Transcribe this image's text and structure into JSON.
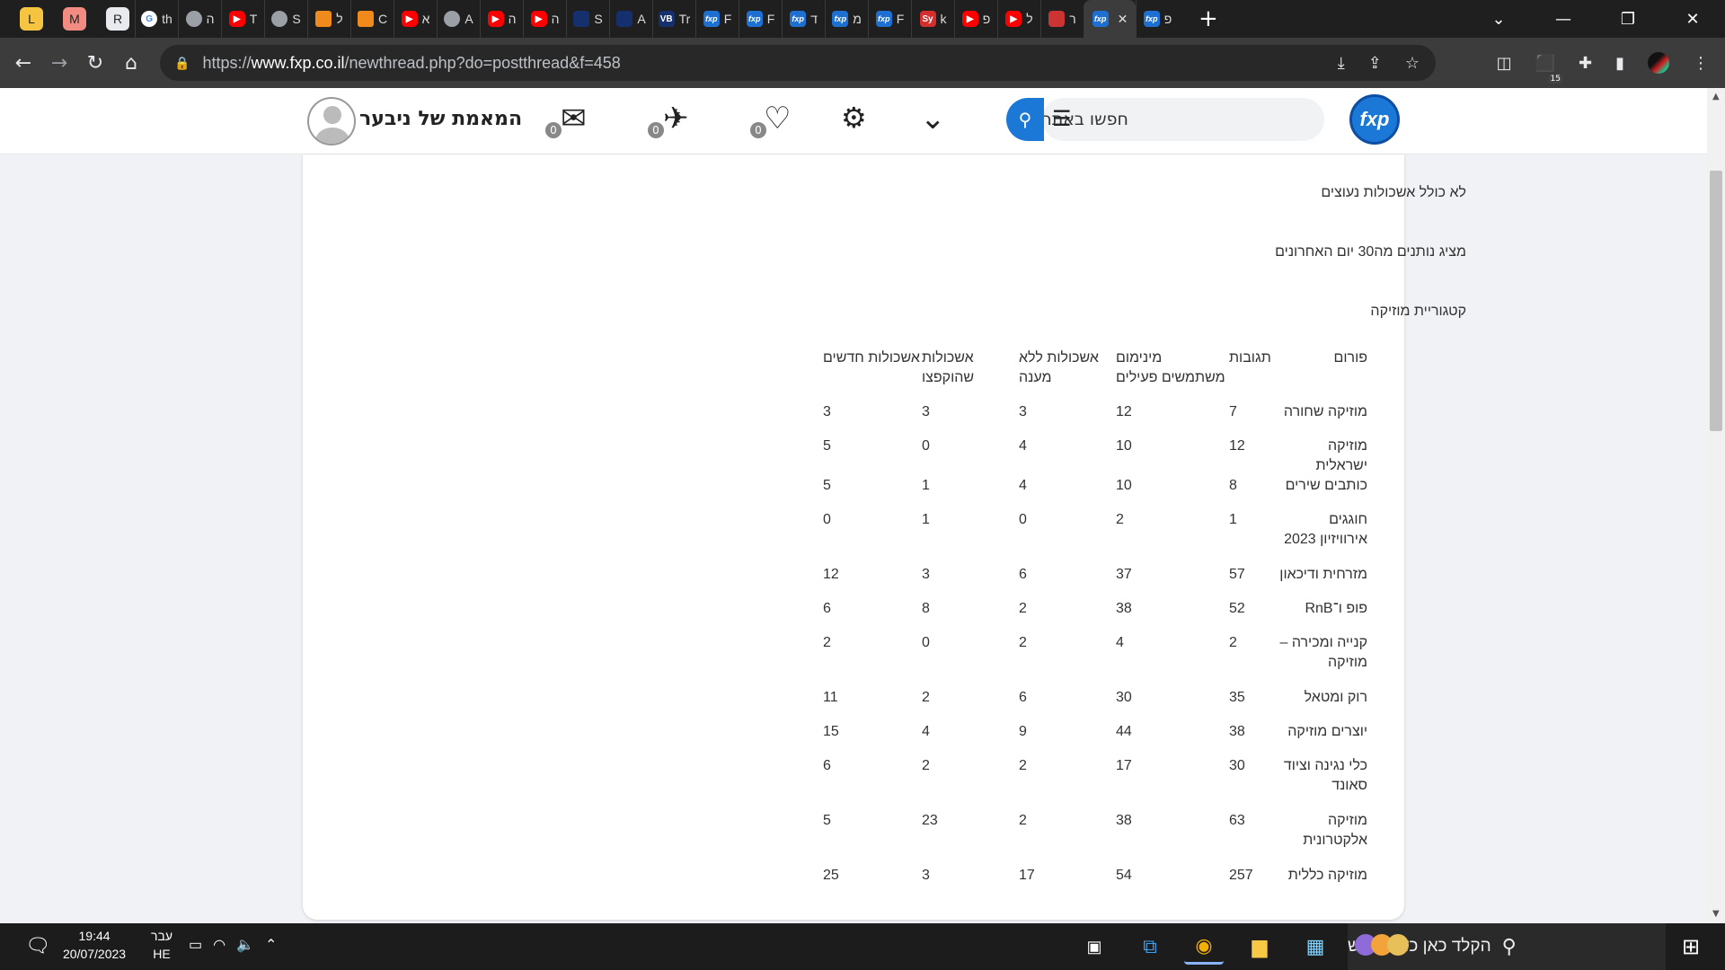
{
  "browser": {
    "pinned_tabs": [
      {
        "letter": "L",
        "color": "#f5c542"
      },
      {
        "letter": "M",
        "color": "#f28b82"
      },
      {
        "letter": "R",
        "color": "#e8eaed"
      }
    ],
    "tabs": [
      {
        "icon": "google",
        "title": "th",
        "type": "g"
      },
      {
        "icon": "globe",
        "title": "ה",
        "type": "globe"
      },
      {
        "icon": "youtube",
        "title": "T",
        "type": "yt"
      },
      {
        "icon": "globe",
        "title": "S",
        "type": "globe"
      },
      {
        "icon": "shield",
        "title": "ל",
        "type": "orange"
      },
      {
        "icon": "grid",
        "title": "C",
        "type": "orange"
      },
      {
        "icon": "youtube",
        "title": "א",
        "type": "yt"
      },
      {
        "icon": "globe",
        "title": "A",
        "type": "globe"
      },
      {
        "icon": "youtube",
        "title": "ה",
        "type": "yt"
      },
      {
        "icon": "youtube",
        "title": "ה",
        "type": "yt"
      },
      {
        "icon": "bank",
        "title": "S",
        "type": "dark"
      },
      {
        "icon": "bank",
        "title": "A",
        "type": "dark"
      },
      {
        "icon": "vb",
        "title": "Tr",
        "type": "dark"
      },
      {
        "icon": "fxp",
        "title": "F",
        "type": "fxp"
      },
      {
        "icon": "fxp",
        "title": "F",
        "type": "fxp"
      },
      {
        "icon": "fxp",
        "title": "ד",
        "type": "fxp"
      },
      {
        "icon": "fxp",
        "title": "מ",
        "type": "fxp"
      },
      {
        "icon": "fxp",
        "title": "F",
        "type": "fxp"
      },
      {
        "icon": "sy",
        "title": "k",
        "type": "red"
      },
      {
        "icon": "youtube",
        "title": "פ",
        "type": "yt"
      },
      {
        "icon": "youtube",
        "title": "ל",
        "type": "yt"
      },
      {
        "icon": "misc",
        "title": "ר",
        "type": "misc"
      },
      {
        "icon": "fxp",
        "title": "",
        "type": "fxp",
        "active": true
      },
      {
        "icon": "fxp",
        "title": "פ",
        "type": "fxp"
      }
    ],
    "url_scheme": "https://",
    "url_host": "www.fxp.co.il",
    "url_path": "/newthread.php?do=postthread&f=458",
    "extension_badge": "15"
  },
  "site": {
    "logo_text": "fxp",
    "search_placeholder": "חפשו באתר",
    "messages_count": "0",
    "sent_count": "0",
    "likes_count": "0",
    "username": "המאמת של ניבער"
  },
  "content": {
    "note1": "לא כולל אשכולות נעוצים",
    "note2": "מציג נותנים מה30 יום האחרונים",
    "category_title": "קטגוריית מוזיקה",
    "table": {
      "headers": [
        "פורום",
        "תגובות",
        "מינימום משתמשים פעילים",
        "אשכולות ללא מענה",
        "אשכולות שהוקפצו",
        "אשכולות חדשים"
      ],
      "rows": [
        [
          "מוזיקה שחורה",
          "7",
          "12",
          "3",
          "3",
          "3"
        ],
        [
          "מוזיקה ישראלית",
          "12",
          "10",
          "4",
          "0",
          "5"
        ],
        [
          "כותבים שירים",
          "8",
          "10",
          "4",
          "1",
          "5"
        ],
        [
          "חוגגים אירוויזיון 2023",
          "1",
          "2",
          "0",
          "1",
          "0"
        ],
        [
          "מזרחית ודיכאון",
          "57",
          "37",
          "6",
          "3",
          "12"
        ],
        [
          "פופ ו־RnB",
          "52",
          "38",
          "2",
          "8",
          "6"
        ],
        [
          "קנייה ומכירה – מוזיקה",
          "2",
          "4",
          "2",
          "0",
          "2"
        ],
        [
          "רוק ומטאל",
          "35",
          "30",
          "6",
          "2",
          "11"
        ],
        [
          "יוצרים מוזיקה",
          "38",
          "44",
          "9",
          "4",
          "15"
        ],
        [
          "כלי נגינה וציוד סאונד",
          "30",
          "17",
          "2",
          "2",
          "6"
        ],
        [
          "מוזיקה אלקטרונית",
          "63",
          "38",
          "2",
          "23",
          "5"
        ],
        [
          "מוזיקה כללית",
          "257",
          "54",
          "17",
          "3",
          "25"
        ]
      ]
    }
  },
  "taskbar": {
    "time": "19:44",
    "date": "20/07/2023",
    "lang_top": "עבר",
    "lang_bottom": "HE",
    "search_placeholder": "הקלד כאן כדי לחפש"
  }
}
